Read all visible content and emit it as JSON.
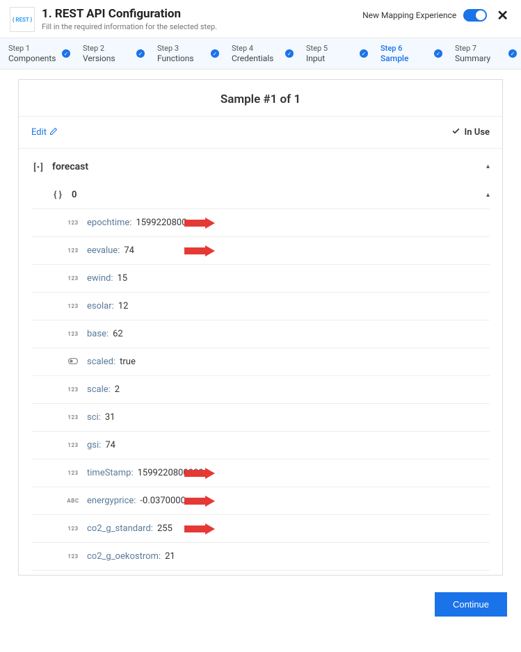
{
  "header": {
    "icon_text": "{ REST }",
    "title": "1. REST API Configuration",
    "subtitle": "Fill in the required information for the selected step.",
    "nme_label": "New Mapping Experience"
  },
  "steps": [
    {
      "num": "Step 1",
      "name": "Components",
      "active": false
    },
    {
      "num": "Step 2",
      "name": "Versions",
      "active": false
    },
    {
      "num": "Step 3",
      "name": "Functions",
      "active": false
    },
    {
      "num": "Step 4",
      "name": "Credentials",
      "active": false
    },
    {
      "num": "Step 5",
      "name": "Input",
      "active": false
    },
    {
      "num": "Step 6",
      "name": "Sample",
      "active": true
    },
    {
      "num": "Step 7",
      "name": "Summary",
      "active": false
    }
  ],
  "card": {
    "sample_title": "Sample #1 of 1",
    "edit_label": "Edit",
    "inuse_label": "In Use"
  },
  "tree": {
    "root_label": "forecast",
    "index_label": "0",
    "fields": [
      {
        "type": "123",
        "key": "epochtime:",
        "value": "1599220800",
        "arrow": true
      },
      {
        "type": "123",
        "key": "eevalue:",
        "value": "74",
        "arrow": true
      },
      {
        "type": "123",
        "key": "ewind:",
        "value": "15",
        "arrow": false
      },
      {
        "type": "123",
        "key": "esolar:",
        "value": "12",
        "arrow": false
      },
      {
        "type": "123",
        "key": "base:",
        "value": "62",
        "arrow": false
      },
      {
        "type": "bool",
        "key": "scaled:",
        "value": "true",
        "arrow": false
      },
      {
        "type": "123",
        "key": "scale:",
        "value": "2",
        "arrow": false
      },
      {
        "type": "123",
        "key": "sci:",
        "value": "31",
        "arrow": false
      },
      {
        "type": "123",
        "key": "gsi:",
        "value": "74",
        "arrow": false
      },
      {
        "type": "123",
        "key": "timeStamp:",
        "value": "1599220800000",
        "arrow": true
      },
      {
        "type": "ABC",
        "key": "energyprice:",
        "value": "-0.0370000",
        "arrow": true
      },
      {
        "type": "123",
        "key": "co2_g_standard:",
        "value": "255",
        "arrow": true
      },
      {
        "type": "123",
        "key": "co2_g_oekostrom:",
        "value": "21",
        "arrow": false
      }
    ]
  },
  "footer": {
    "continue_label": "Continue"
  }
}
